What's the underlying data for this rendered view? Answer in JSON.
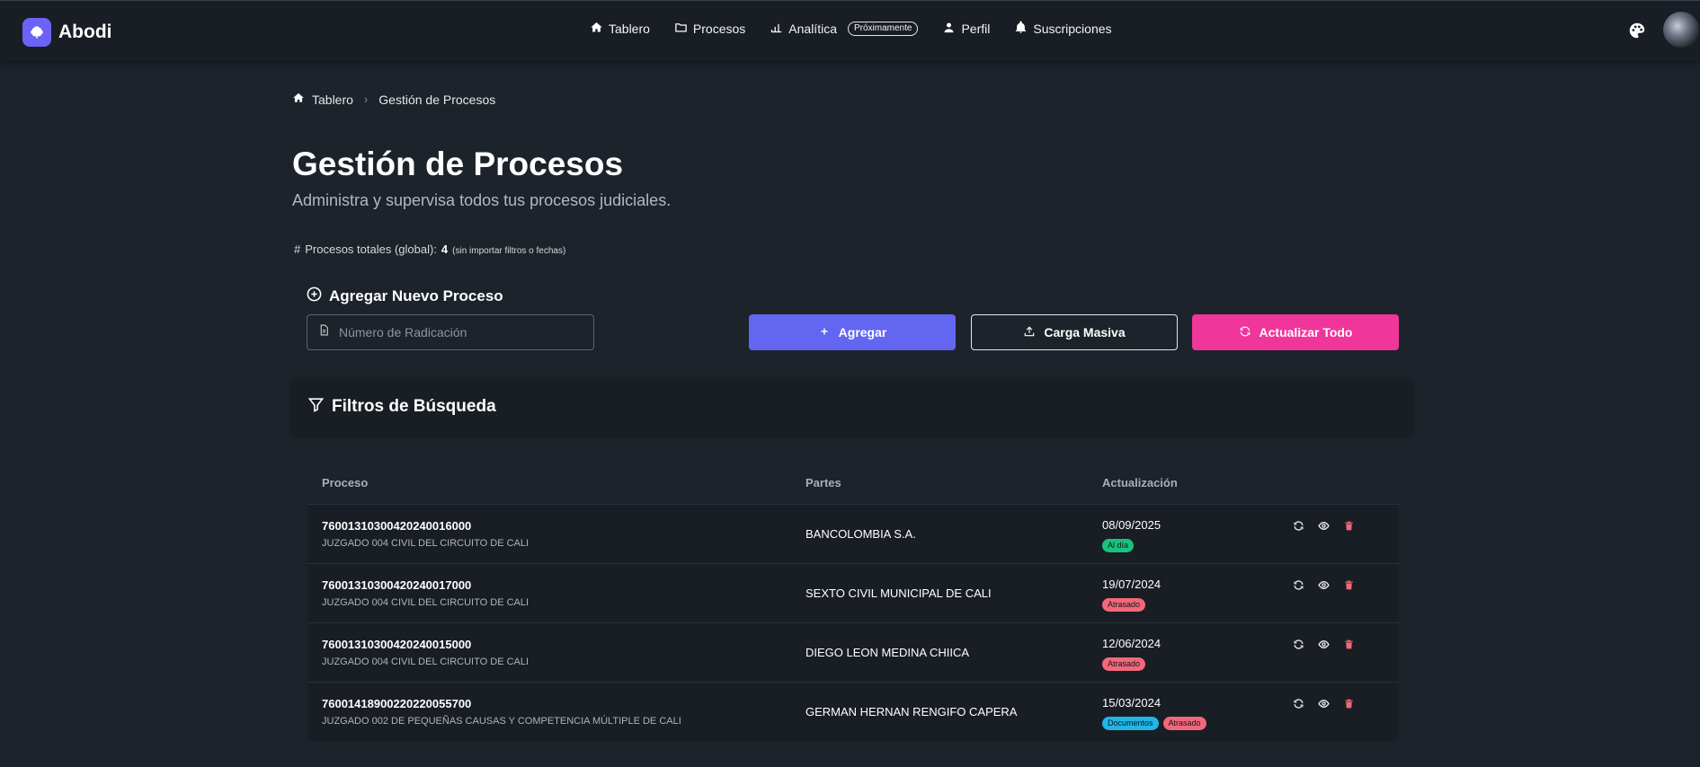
{
  "brand": {
    "name": "Abodi"
  },
  "nav": {
    "items": [
      {
        "label": "Tablero",
        "icon": "home-icon"
      },
      {
        "label": "Procesos",
        "icon": "folder-icon"
      },
      {
        "label": "Analítica",
        "icon": "chart-icon",
        "badge": "Próximamente"
      },
      {
        "label": "Perfil",
        "icon": "user-icon"
      },
      {
        "label": "Suscripciones",
        "icon": "bell-icon"
      }
    ]
  },
  "breadcrumb": {
    "home": "Tablero",
    "current": "Gestión de Procesos"
  },
  "page": {
    "title": "Gestión de Procesos",
    "subtitle": "Administra y supervisa todos tus procesos judiciales.",
    "total_prefix": "#",
    "total_label": "Procesos totales (global):",
    "total_count": "4",
    "total_note": "(sin importar filtros o fechas)"
  },
  "add_process": {
    "title": "Agregar Nuevo Proceso",
    "input_placeholder": "Número de Radicación",
    "input_value": "",
    "add_button": "Agregar",
    "bulk_button": "Carga Masiva",
    "refresh_button": "Actualizar Todo"
  },
  "filters": {
    "title": "Filtros de Búsqueda"
  },
  "colors": {
    "primary": "#6366f1",
    "accent": "#f0359b",
    "status_ok": "#19c37d",
    "status_late": "#f2687a",
    "status_docs": "#1fb6e8"
  },
  "table": {
    "headers": {
      "process": "Proceso",
      "parties": "Partes",
      "update": "Actualización"
    },
    "rows": [
      {
        "code": "76001310300420240016000",
        "court": "JUZGADO 004 CIVIL DEL CIRCUITO DE CALI",
        "party": "BANCOLOMBIA S.A.",
        "date": "08/09/2025",
        "tags": [
          {
            "label": "Al día",
            "type": "ok"
          }
        ]
      },
      {
        "code": "76001310300420240017000",
        "court": "JUZGADO 004 CIVIL DEL CIRCUITO DE CALI",
        "party": "SEXTO CIVIL MUNICIPAL DE CALI",
        "date": "19/07/2024",
        "tags": [
          {
            "label": "Atrasado",
            "type": "late"
          }
        ]
      },
      {
        "code": "76001310300420240015000",
        "court": "JUZGADO 004 CIVIL DEL CIRCUITO DE CALI",
        "party": "DIEGO LEON MEDINA CHIICA",
        "date": "12/06/2024",
        "tags": [
          {
            "label": "Atrasado",
            "type": "late"
          }
        ]
      },
      {
        "code": "76001418900220220055700",
        "court": "JUZGADO 002 DE PEQUEÑAS CAUSAS Y COMPETENCIA MÚLTIPLE DE CALI",
        "party": "GERMAN HERNAN RENGIFO CAPERA",
        "date": "15/03/2024",
        "tags": [
          {
            "label": "Documentos",
            "type": "doc"
          },
          {
            "label": "Atrasado",
            "type": "late"
          }
        ]
      }
    ],
    "row_actions": [
      "refresh-icon",
      "eye-icon",
      "trash-icon"
    ]
  }
}
